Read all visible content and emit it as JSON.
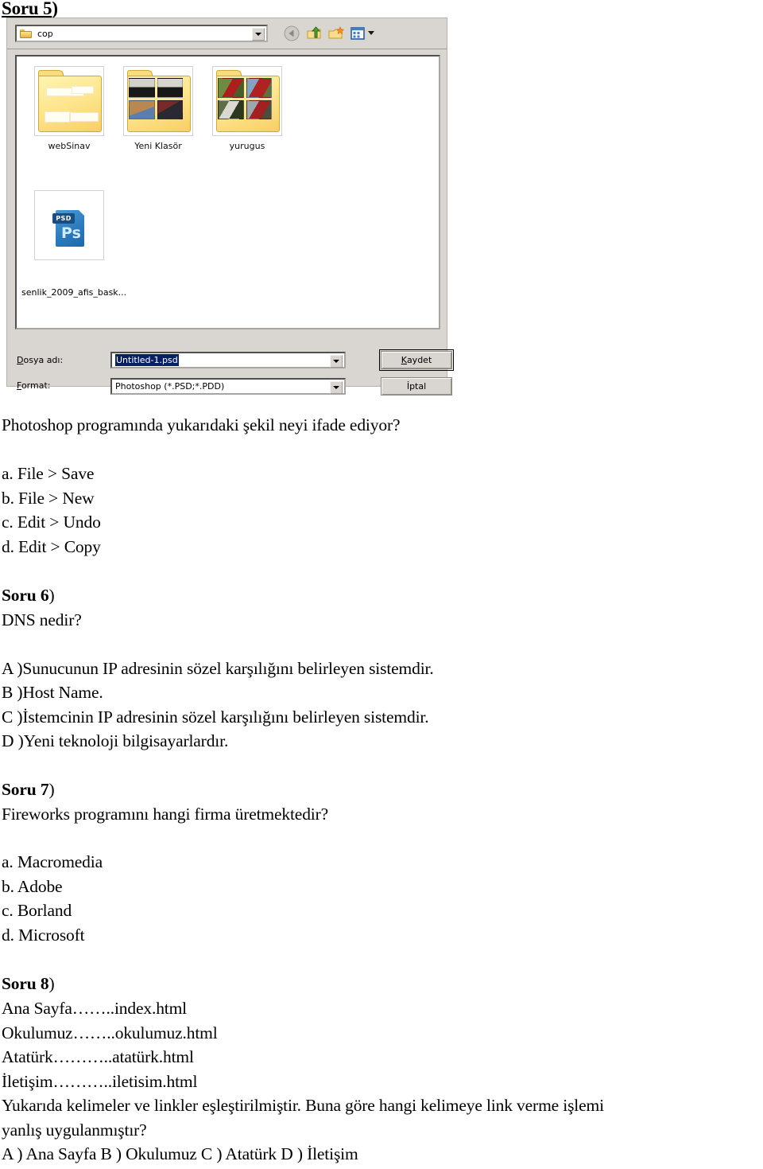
{
  "document": {
    "type": "exam-question-sheet",
    "language": "tr"
  },
  "question5": {
    "heading_label": "Soru 5",
    "heading_paren": ")",
    "prompt": "Photoshop programında yukarıdaki şekil neyi ifade ediyor?",
    "options": [
      "a. File > Save",
      "b. File > New",
      "c. Edit > Undo",
      "d. Edit > Copy"
    ]
  },
  "save_dialog": {
    "lookin": {
      "icon": "folder-icon",
      "value": "cop",
      "dropdown_icon": "chevron-down-icon"
    },
    "toolbar": [
      {
        "name": "back-icon",
        "title": "Back"
      },
      {
        "name": "up-one-level-icon",
        "title": "Up One Level"
      },
      {
        "name": "new-folder-icon",
        "title": "Create New Folder"
      },
      {
        "name": "views-icon",
        "title": "Views"
      }
    ],
    "items": [
      {
        "name": "webSinav",
        "kind": "folder"
      },
      {
        "name": "Yeni Klasör",
        "kind": "folder"
      },
      {
        "name": "yurugus",
        "kind": "folder"
      },
      {
        "name": "senlik_2009_afis_bask...",
        "kind": "psd-file",
        "badge": "PSD",
        "glyph": "Ps"
      }
    ],
    "filename_field": {
      "label_underlined": "D",
      "label_rest": "osya adı:",
      "value": "Untitled-1.psd",
      "selected": true
    },
    "format_field": {
      "label_underlined": "F",
      "label_rest": "ormat:",
      "value": "Photoshop (*.PSD;*.PDD)"
    },
    "buttons": {
      "save_underlined": "K",
      "save_rest": "aydet",
      "cancel": "İptal"
    },
    "colors": {
      "dialog_face": "#d6d3ce",
      "selection_blue": "#0a246a",
      "folder_yellow": "#fbe28b",
      "psd_blue": "#2b7cc0"
    }
  },
  "question6": {
    "heading_label": "Soru 6",
    "heading_paren": ")",
    "prompt": "DNS nedir?",
    "options": [
      "A )Sunucunun IP adresinin sözel karşılığını belirleyen sistemdir.",
      "B )Host Name.",
      "C )İstemcinin IP adresinin sözel karşılığını belirleyen sistemdir.",
      "D )Yeni teknoloji bilgisayarlardır."
    ]
  },
  "question7": {
    "heading_label": "Soru 7",
    "heading_paren": ")",
    "prompt": "Fireworks programını hangi firma üretmektedir?",
    "options": [
      "a. Macromedia",
      "b. Adobe",
      "c. Borland",
      "d. Microsoft"
    ]
  },
  "question8": {
    "heading_label": "Soru 8",
    "heading_paren": ")",
    "pairs": [
      "Ana Sayfa……..index.html",
      "Okulumuz……..okulumuz.html",
      "Atatürk………..atatürk.html",
      "İletişim………..iletisim.html"
    ],
    "prompt_line1": "Yukarıda kelimeler ve linkler eşleştirilmiştir. Buna göre hangi kelimeye link verme işlemi",
    "prompt_line2": "yanlış uygulanmıştır?",
    "answers_line": "A ) Ana Sayfa B ) Okulumuz C ) Atatürk D ) İletişim"
  }
}
